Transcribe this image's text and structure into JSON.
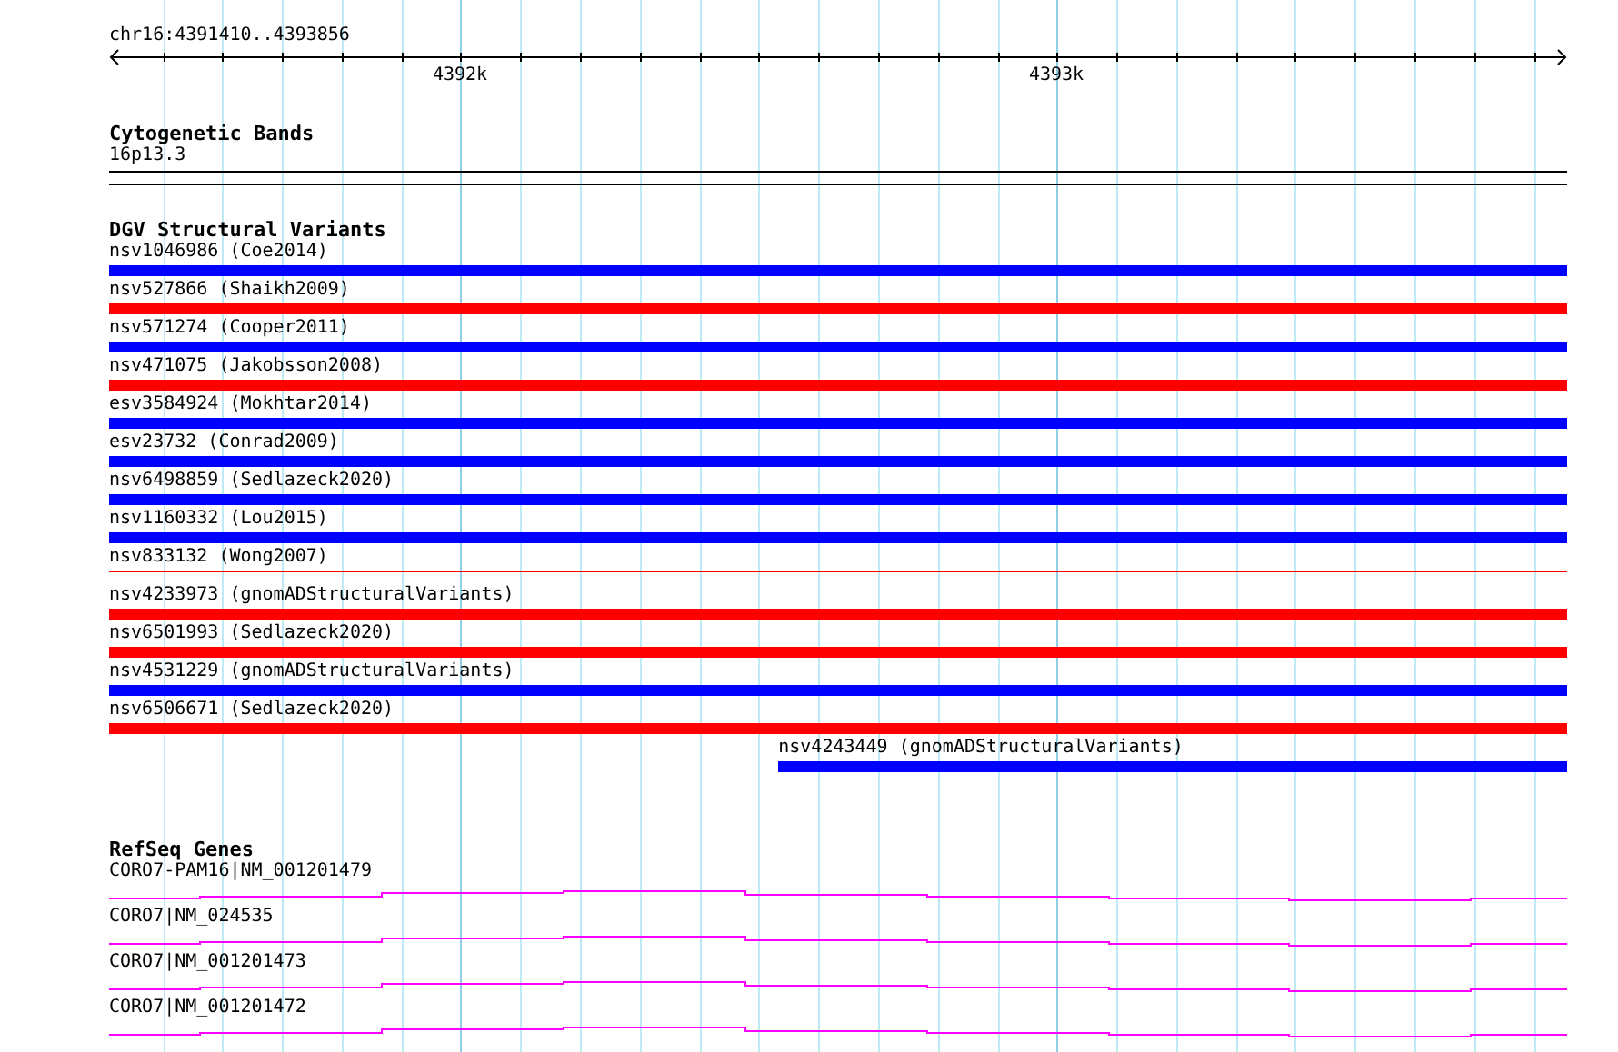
{
  "location": "chr16:4391410..4393856",
  "ruler": {
    "labels": [
      {
        "text": "4392k"
      },
      {
        "text": "4393k"
      }
    ]
  },
  "cytogenetic_bands": {
    "title": "Cytogenetic Bands",
    "bands": [
      {
        "name": "16p13.3"
      }
    ]
  },
  "dgv": {
    "title": "DGV Structural Variants",
    "variants": [
      {
        "label": "nsv1046986 (Coe2014)",
        "color": "#0000ff",
        "thin": false,
        "kind": "full"
      },
      {
        "label": "nsv527866 (Shaikh2009)",
        "color": "#ff0000",
        "thin": false,
        "kind": "full"
      },
      {
        "label": "nsv571274 (Cooper2011)",
        "color": "#0000ff",
        "thin": false,
        "kind": "full"
      },
      {
        "label": "nsv471075 (Jakobsson2008)",
        "color": "#ff0000",
        "thin": false,
        "kind": "full"
      },
      {
        "label": "esv3584924 (Mokhtar2014)",
        "color": "#0000ff",
        "thin": false,
        "kind": "full"
      },
      {
        "label": "esv23732 (Conrad2009)",
        "color": "#0000ff",
        "thin": false,
        "kind": "full"
      },
      {
        "label": "nsv6498859 (Sedlazeck2020)",
        "color": "#0000ff",
        "thin": false,
        "kind": "full"
      },
      {
        "label": "nsv1160332 (Lou2015)",
        "color": "#0000ff",
        "thin": false,
        "kind": "full"
      },
      {
        "label": "nsv833132 (Wong2007)",
        "color": "#ff0000",
        "thin": true,
        "kind": "full"
      },
      {
        "label": "nsv4233973 (gnomADStructuralVariants)",
        "color": "#ff0000",
        "thin": false,
        "kind": "full"
      },
      {
        "label": "nsv6501993 (Sedlazeck2020)",
        "color": "#ff0000",
        "thin": false,
        "kind": "full"
      },
      {
        "label": "nsv4531229 (gnomADStructuralVariants)",
        "color": "#0000ff",
        "thin": false,
        "kind": "full"
      },
      {
        "label": "nsv6506671 (Sedlazeck2020)",
        "color": "#ff0000",
        "thin": false,
        "kind": "full"
      },
      {
        "label": "nsv4243449 (gnomADStructuralVariants)",
        "color": "#0000ff",
        "thin": false,
        "kind": "right-part"
      }
    ]
  },
  "refseq": {
    "title": "RefSeq Genes",
    "transcripts": [
      {
        "label": "CORO7-PAM16|NM_001201479"
      },
      {
        "label": "CORO7|NM_024535"
      },
      {
        "label": "CORO7|NM_001201473"
      },
      {
        "label": "CORO7|NM_001201472"
      }
    ]
  }
}
